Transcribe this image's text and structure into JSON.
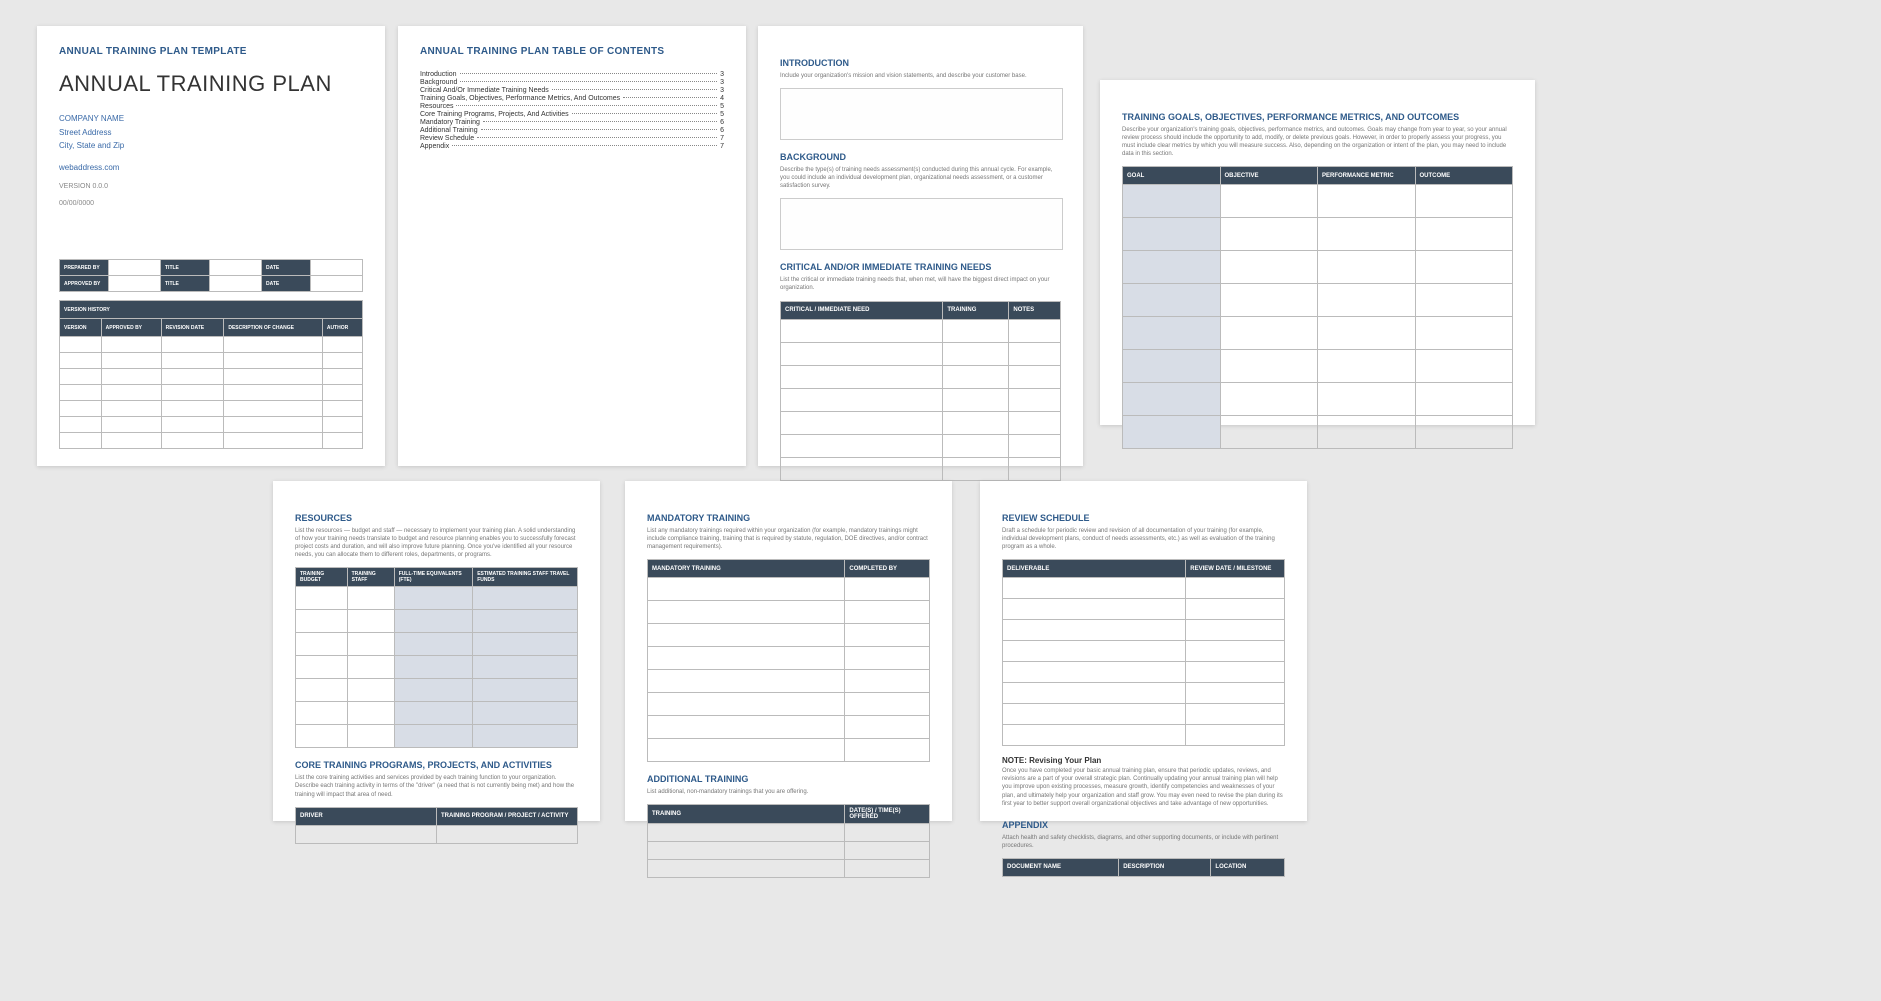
{
  "p1": {
    "header": "ANNUAL TRAINING PLAN TEMPLATE",
    "title": "ANNUAL TRAINING PLAN",
    "company": "COMPANY NAME",
    "street": "Street Address",
    "city": "City, State and Zip",
    "web": "webaddress.com",
    "version": "VERSION 0.0.0",
    "date": "00/00/0000",
    "prep1a": "PREPARED BY",
    "prep1b": "TITLE",
    "prep1c": "DATE",
    "prep2a": "APPROVED BY",
    "prep2b": "TITLE",
    "prep2c": "DATE",
    "vh": "VERSION HISTORY",
    "vh_cols": [
      "VERSION",
      "APPROVED BY",
      "REVISION DATE",
      "DESCRIPTION OF CHANGE",
      "AUTHOR"
    ]
  },
  "p2": {
    "header": "ANNUAL TRAINING PLAN TABLE OF CONTENTS",
    "toc": [
      {
        "t": "Introduction",
        "p": "3"
      },
      {
        "t": "Background",
        "p": "3"
      },
      {
        "t": "Critical And/Or Immediate Training Needs",
        "p": "3"
      },
      {
        "t": "Training Goals, Objectives, Performance Metrics, And Outcomes",
        "p": "4"
      },
      {
        "t": "Resources",
        "p": "5"
      },
      {
        "t": "Core Training Programs, Projects, And Activities",
        "p": "5"
      },
      {
        "t": "Mandatory Training",
        "p": "6"
      },
      {
        "t": "Additional Training",
        "p": "6"
      },
      {
        "t": "Review Schedule",
        "p": "7"
      },
      {
        "t": "Appendix",
        "p": "7"
      }
    ]
  },
  "p3": {
    "s1": "INTRODUCTION",
    "s1d": "Include your organization's mission and vision statements, and describe your customer base.",
    "s2": "BACKGROUND",
    "s2d": "Describe the type(s) of training needs assessment(s) conducted during this annual cycle. For example, you could include an individual development plan, organizational needs assessment, or a customer satisfaction survey.",
    "s3": "CRITICAL AND/OR IMMEDIATE TRAINING NEEDS",
    "s3d": "List the critical or immediate training needs that, when met, will have the biggest direct impact on your organization.",
    "cols": [
      "CRITICAL / IMMEDIATE NEED",
      "TRAINING",
      "NOTES"
    ]
  },
  "p4": {
    "s1": "TRAINING GOALS, OBJECTIVES, PERFORMANCE METRICS, AND OUTCOMES",
    "s1d": "Describe your organization's training goals, objectives, performance metrics, and outcomes. Goals may change from year to year, so your annual review process should include the opportunity to add, modify, or delete previous goals. However, in order to properly assess your progress, you must include clear metrics by which you will measure success. Also, depending on the organization or intent of the plan, you may need to include data in this section.",
    "cols": [
      "GOAL",
      "OBJECTIVE",
      "PERFORMANCE METRIC",
      "OUTCOME"
    ]
  },
  "p5": {
    "s1": "RESOURCES",
    "s1d": "List the resources — budget and staff — necessary to implement your training plan. A solid understanding of how your training needs translate to budget and resource planning enables you to successfully forecast project costs and duration, and will also improve future planning. Once you've identified all your resource needs, you can allocate them to different roles, departments, or programs.",
    "cols": [
      "TRAINING BUDGET",
      "TRAINING STAFF",
      "FULL-TIME EQUIVALENTS (FTE)",
      "ESTIMATED TRAINING STAFF TRAVEL FUNDS"
    ],
    "s2": "CORE TRAINING PROGRAMS, PROJECTS, AND ACTIVITIES",
    "s2d": "List the core training activities and services provided by each training function to your organization. Describe each training activity in terms of the \"driver\" (a need that is not currently being met) and how the training will impact that area of need.",
    "cols2": [
      "DRIVER",
      "TRAINING PROGRAM / PROJECT / ACTIVITY"
    ]
  },
  "p6": {
    "s1": "MANDATORY TRAINING",
    "s1d": "List any mandatory trainings required within your organization (for example, mandatory trainings might include compliance training, training that is required by statute, regulation, DOE directives, and/or contract management requirements).",
    "cols": [
      "MANDATORY TRAINING",
      "COMPLETED BY"
    ],
    "s2": "ADDITIONAL TRAINING",
    "s2d": "List additional, non-mandatory trainings that you are offering.",
    "cols2": [
      "TRAINING",
      "DATE(S) / TIME(S) OFFERED"
    ]
  },
  "p7": {
    "s1": "REVIEW SCHEDULE",
    "s1d": "Draft a schedule for periodic review and revision of all documentation of your training (for example, individual development plans, conduct of needs assessments, etc.) as well as evaluation of the training program as a whole.",
    "cols": [
      "DELIVERABLE",
      "REVIEW DATE / MILESTONE"
    ],
    "note": "NOTE: Revising Your Plan",
    "noted": "Once you have completed your basic annual training plan, ensure that periodic updates, reviews, and revisions are a part of your overall strategic plan. Continually updating your annual training plan will help you improve upon existing processes, measure growth, identify competencies and weaknesses of your plan, and ultimately help your organization and staff grow. You may even need to revise the plan during its first year to better support overall organizational objectives and take advantage of new opportunities.",
    "s2": "APPENDIX",
    "s2d": "Attach health and safety checklists, diagrams, and other supporting documents, or include with pertinent procedures.",
    "cols2": [
      "DOCUMENT NAME",
      "DESCRIPTION",
      "LOCATION"
    ]
  }
}
